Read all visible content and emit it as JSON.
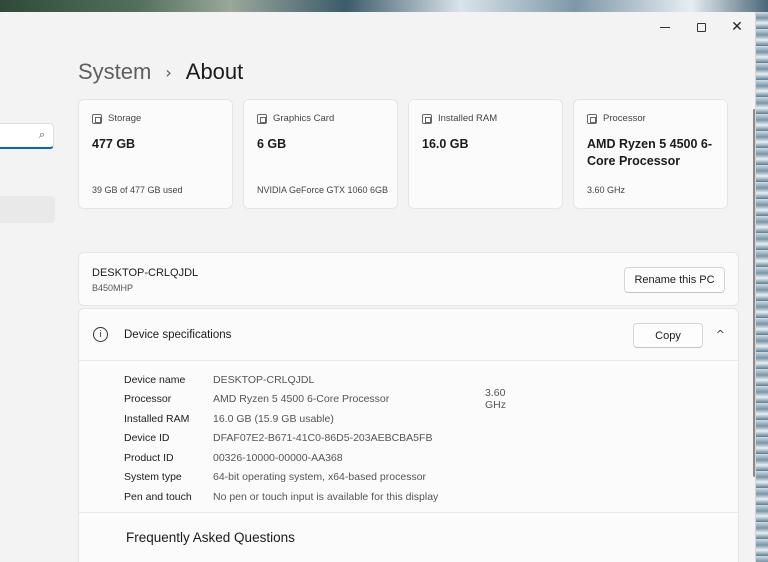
{
  "window": {
    "minimize_glyph": "",
    "maximize_glyph": "",
    "close_glyph": "✕"
  },
  "sidebar": {
    "search_icon": "⌕",
    "search_placeholder": ""
  },
  "breadcrumb": {
    "parent": "System",
    "separator": "›",
    "current": "About"
  },
  "cards": [
    {
      "icon": "storage-icon",
      "label": "Storage",
      "value": "477 GB",
      "sub": "39 GB of 477 GB used"
    },
    {
      "icon": "graphics-card-icon",
      "label": "Graphics Card",
      "value": "6 GB",
      "sub": "NVIDIA GeForce GTX 1060 6GB"
    },
    {
      "icon": "ram-icon",
      "label": "Installed RAM",
      "value": "16.0 GB",
      "sub": ""
    },
    {
      "icon": "processor-icon",
      "label": "Processor",
      "value": "AMD Ryzen 5 4500 6-Core Processor",
      "sub": "3.60 GHz"
    }
  ],
  "pc": {
    "name": "DESKTOP-CRLQJDL",
    "model": "B450MHP",
    "rename_label": "Rename this PC"
  },
  "specs": {
    "info_glyph": "i",
    "title": "Device specifications",
    "copy_label": "Copy",
    "chevron_glyph": "^",
    "rows": [
      {
        "label": "Device name",
        "value": "DESKTOP-CRLQJDL",
        "extra": ""
      },
      {
        "label": "Processor",
        "value": "AMD Ryzen 5 4500 6-Core Processor",
        "extra": "3.60 GHz"
      },
      {
        "label": "Installed RAM",
        "value": "16.0 GB (15.9 GB usable)",
        "extra": ""
      },
      {
        "label": "Device ID",
        "value": "DFAF07E2-B671-41C0-86D5-203AEBCBA5FB",
        "extra": ""
      },
      {
        "label": "Product ID",
        "value": "00326-10000-00000-AA368",
        "extra": ""
      },
      {
        "label": "System type",
        "value": "64-bit operating system, x64-based processor",
        "extra": ""
      },
      {
        "label": "Pen and touch",
        "value": "No pen or touch input is available for this display",
        "extra": ""
      }
    ],
    "faq_title": "Frequently Asked Questions"
  }
}
